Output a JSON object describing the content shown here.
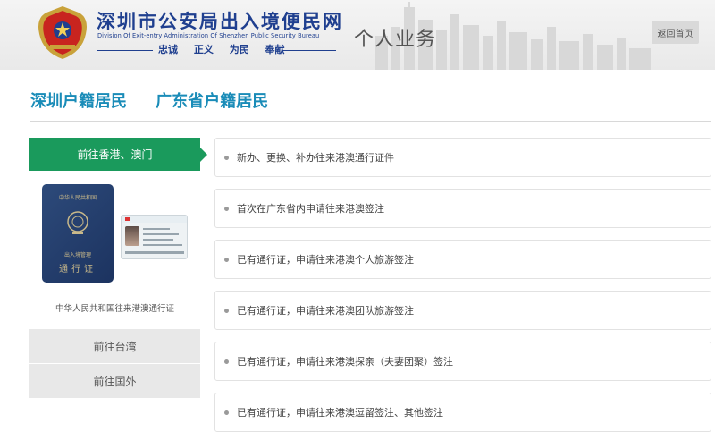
{
  "header": {
    "site_title": "深圳市公安局出入境便民网",
    "site_subtitle": "Division Of Exit-entry Administration Of Shenzhen Public Security Bureau",
    "motto": [
      "忠诚",
      "正义",
      "为民",
      "奉献"
    ],
    "section_title": "个人业务",
    "home_button": "返回首页"
  },
  "category_tabs": [
    {
      "label": "深圳户籍居民"
    },
    {
      "label": "广东省户籍居民"
    }
  ],
  "sidebar": {
    "active_item": "前往香港、澳门",
    "document_caption": "中华人民共和国往来港澳通行证",
    "passport_top_text": "中华人民共和国",
    "passport_mid_text": "出入境管理",
    "passport_bottom_text": "通行证",
    "items": [
      {
        "label": "前往台湾"
      },
      {
        "label": "前往国外"
      }
    ]
  },
  "services": [
    {
      "label": "新办、更换、补办往来港澳通行证件"
    },
    {
      "label": "首次在广东省内申请往来港澳签注"
    },
    {
      "label": "已有通行证，申请往来港澳个人旅游签注"
    },
    {
      "label": "已有通行证，申请往来港澳团队旅游签注"
    },
    {
      "label": "已有通行证，申请往来港澳探亲（夫妻团聚）签注"
    },
    {
      "label": "已有通行证，申请往来港澳逗留签注、其他签注"
    }
  ],
  "colors": {
    "accent_green": "#1a9a5c",
    "tab_blue": "#1a8cb8",
    "title_navy": "#1f3f8f"
  }
}
